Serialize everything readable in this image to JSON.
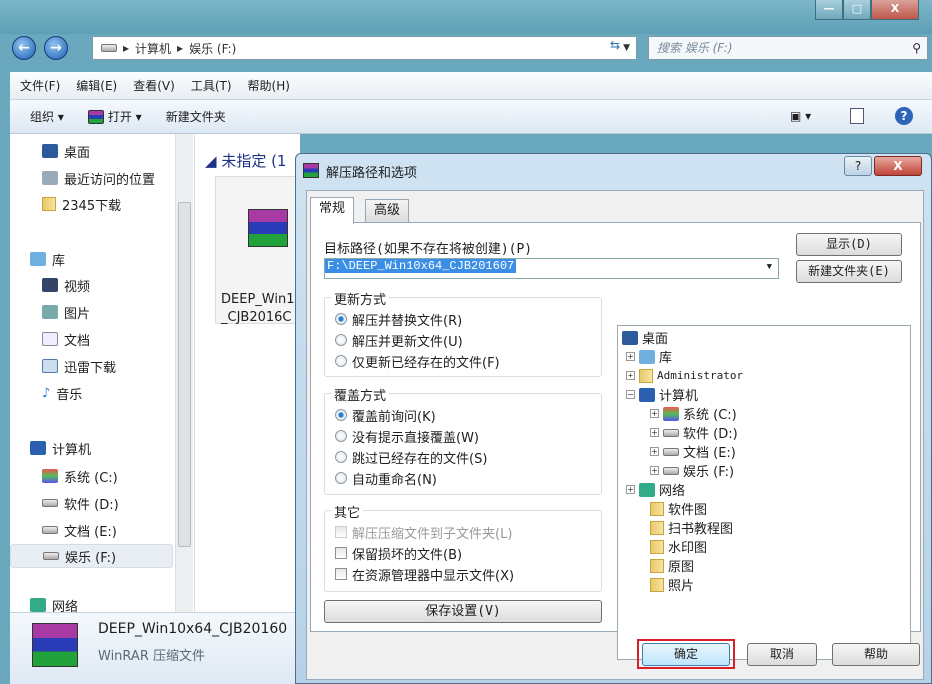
{
  "window": {
    "controls": {
      "minimize": "—",
      "maximize": "□",
      "close": "X"
    }
  },
  "address": {
    "crumbs": [
      "计算机",
      "娱乐 (F:)"
    ],
    "search_placeholder": "搜索 娱乐 (F:)"
  },
  "menu": [
    "文件(F)",
    "编辑(E)",
    "查看(V)",
    "工具(T)",
    "帮助(H)"
  ],
  "toolbar": {
    "organize": "组织 ▾",
    "open": "打开 ▾",
    "new_folder": "新建文件夹"
  },
  "sidebar": {
    "favorites": [
      "桌面",
      "最近访问的位置",
      "2345下载"
    ],
    "library": "库",
    "library_items": [
      "视频",
      "图片",
      "文档",
      "迅雷下载",
      "音乐"
    ],
    "computer": "计算机",
    "drives": [
      "系统 (C:)",
      "软件 (D:)",
      "文档 (E:)",
      "娱乐 (F:)"
    ],
    "network": "网络"
  },
  "content": {
    "group_header": "未指定 (1",
    "file_name_line1": "DEEP_Win1",
    "file_name_line2": "_CJB2016C"
  },
  "details": {
    "name": "DEEP_Win10x64_CJB20160",
    "type": "WinRAR 压缩文件"
  },
  "dialog": {
    "title": "解压路径和选项",
    "help_btn": "?",
    "close_btn": "X",
    "tabs": [
      "常规",
      "高级"
    ],
    "path_label": "目标路径(如果不存在将被创建)(P)",
    "path_value": "F:\\DEEP_Win10x64_CJB201607",
    "show_btn": "显示(D)",
    "new_folder_btn": "新建文件夹(E)",
    "update_group": {
      "title": "更新方式",
      "options": [
        "解压并替换文件(R)",
        "解压并更新文件(U)",
        "仅更新已经存在的文件(F)"
      ],
      "selected": 0
    },
    "overwrite_group": {
      "title": "覆盖方式",
      "options": [
        "覆盖前询问(K)",
        "没有提示直接覆盖(W)",
        "跳过已经存在的文件(S)",
        "自动重命名(N)"
      ],
      "selected": 0
    },
    "other_group": {
      "title": "其它",
      "options": [
        "解压压缩文件到子文件夹(L)",
        "保留损坏的文件(B)",
        "在资源管理器中显示文件(X)"
      ],
      "disabled": [
        0
      ]
    },
    "save_btn": "保存设置(V)",
    "tree": [
      "桌面",
      "库",
      "Administrator",
      "计算机",
      "系统 (C:)",
      "软件 (D:)",
      "文档 (E:)",
      "娱乐 (F:)",
      "网络",
      "软件图",
      "扫书教程图",
      "水印图",
      "原图",
      "照片"
    ],
    "ok": "确定",
    "cancel": "取消",
    "help": "帮助",
    "highlight_color": "#d9202a"
  }
}
